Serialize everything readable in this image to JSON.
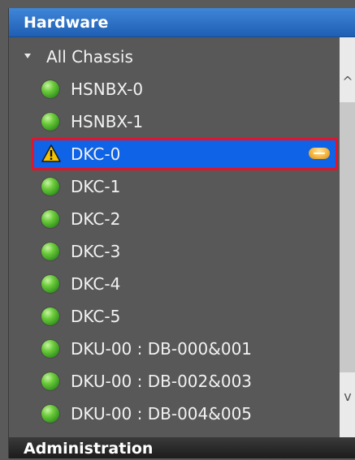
{
  "header": {
    "title": "Hardware"
  },
  "tree": {
    "root": {
      "label": "All Chassis",
      "expand_icon": "expand-triangle-icon"
    },
    "items": [
      {
        "label": "HSNBX-0",
        "status_icon": "green-status-icon"
      },
      {
        "label": "HSNBX-1",
        "status_icon": "green-status-icon"
      },
      {
        "label": "DKC-0",
        "status_icon": "warning-icon",
        "badge_icon": "minus-status-badge-icon",
        "selected": true
      },
      {
        "label": "DKC-1",
        "status_icon": "green-status-icon"
      },
      {
        "label": "DKC-2",
        "status_icon": "green-status-icon"
      },
      {
        "label": "DKC-3",
        "status_icon": "green-status-icon"
      },
      {
        "label": "DKC-4",
        "status_icon": "green-status-icon"
      },
      {
        "label": "DKC-5",
        "status_icon": "green-status-icon"
      },
      {
        "label": "DKU-00 : DB-000&001",
        "status_icon": "green-status-icon"
      },
      {
        "label": "DKU-00 : DB-002&003",
        "status_icon": "green-status-icon"
      },
      {
        "label": "DKU-00 : DB-004&005",
        "status_icon": "green-status-icon"
      }
    ]
  },
  "scrollbar": {
    "up_icon": "scroll-up-chevron-icon",
    "down_icon": "scroll-down-chevron-icon",
    "up_glyph": "^",
    "down_glyph": "v"
  },
  "footer": {
    "title": "Administration"
  },
  "colors": {
    "header_bg": "#2a6fca",
    "selection_bg": "#0e63e6",
    "selection_outline": "#e0142a",
    "status_ok": "#5cc22e",
    "status_warning": "#f5c400"
  }
}
